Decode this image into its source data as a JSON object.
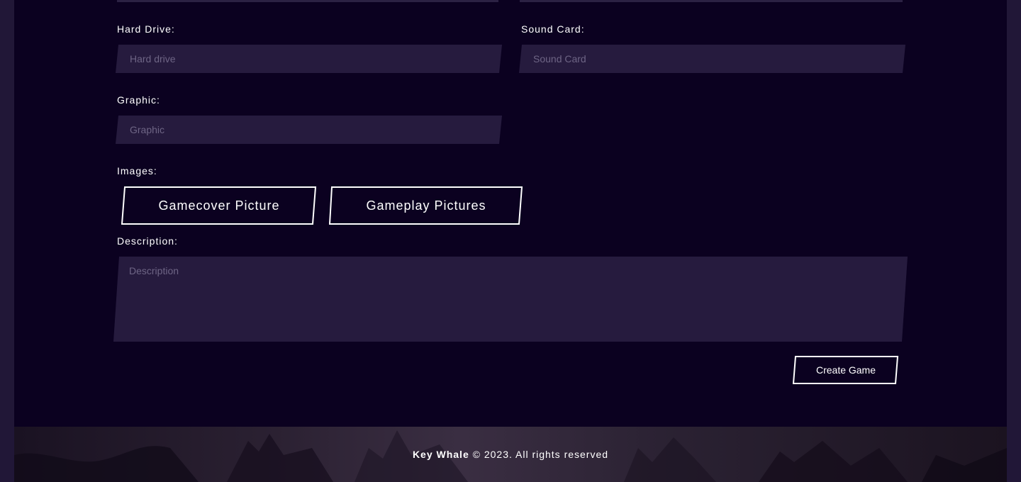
{
  "form": {
    "hard_drive": {
      "label": "Hard Drive:",
      "placeholder": "Hard drive"
    },
    "sound_card": {
      "label": "Sound Card:",
      "placeholder": "Sound Card"
    },
    "graphic": {
      "label": "Graphic:",
      "placeholder": "Graphic"
    },
    "images": {
      "label": "Images:",
      "gamecover_button": "Gamecover Picture",
      "gameplay_button": "Gameplay Pictures"
    },
    "description": {
      "label": "Description:",
      "placeholder": "Description"
    },
    "submit_label": "Create Game"
  },
  "footer": {
    "brand": "Key Whale",
    "rights": "© 2023. All rights reserved"
  },
  "colors": {
    "page_bg": "#0b0120",
    "input_bg": "#261b3e",
    "text": "#ffffff",
    "placeholder": "#6e6585"
  }
}
